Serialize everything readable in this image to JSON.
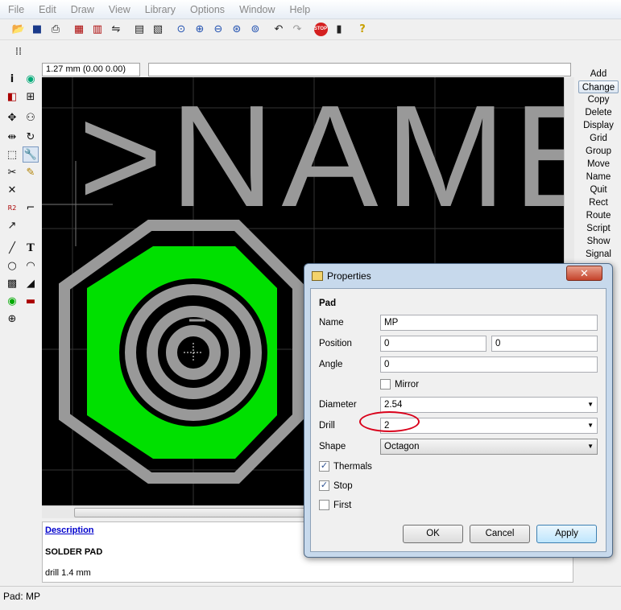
{
  "menu": [
    "File",
    "Edit",
    "Draw",
    "View",
    "Library",
    "Options",
    "Window",
    "Help"
  ],
  "coord": {
    "readout": "1.27 mm (0.00 0.00)"
  },
  "canvas": {
    "name_text": ">NAME"
  },
  "commands": [
    "Add",
    "Change",
    "Copy",
    "Delete",
    "Display",
    "Grid",
    "Group",
    "Move",
    "Name",
    "Quit",
    "Rect",
    "Route",
    "Script",
    "Show",
    "Signal"
  ],
  "description": {
    "link": "Description",
    "title": "SOLDER PAD",
    "body": "drill 1.4 mm"
  },
  "status": {
    "text": "Pad: MP"
  },
  "dialog": {
    "title": "Properties",
    "close": "✕",
    "section": "Pad",
    "name_label": "Name",
    "name_value": "MP",
    "position_label": "Position",
    "position_x": "0",
    "position_y": "0",
    "angle_label": "Angle",
    "angle_value": "0",
    "mirror_label": "Mirror",
    "mirror_checked": false,
    "diameter_label": "Diameter",
    "diameter_value": "2.54",
    "drill_label": "Drill",
    "drill_value": "2",
    "shape_label": "Shape",
    "shape_value": "Octagon",
    "thermals_label": "Thermals",
    "thermals_checked": true,
    "stop_label": "Stop",
    "stop_checked": true,
    "first_label": "First",
    "first_checked": false,
    "ok": "OK",
    "cancel": "Cancel",
    "apply": "Apply"
  },
  "colors": {
    "pad_copper": "#00e000",
    "pad_outline": "#999999",
    "canvas_bg": "#000000",
    "highlight": "#d9001a"
  },
  "icons": {
    "toolbar": [
      "open-icon",
      "save-icon",
      "print-icon",
      "cam-icon",
      "ulp-icon",
      "script-icon",
      "zoom-fit-icon",
      "zoom-in-icon",
      "zoom-out-icon",
      "zoom-redraw-icon",
      "zoom-select-icon",
      "undo-icon",
      "redo-icon",
      "stop-icon",
      "go-icon",
      "help-icon"
    ]
  }
}
